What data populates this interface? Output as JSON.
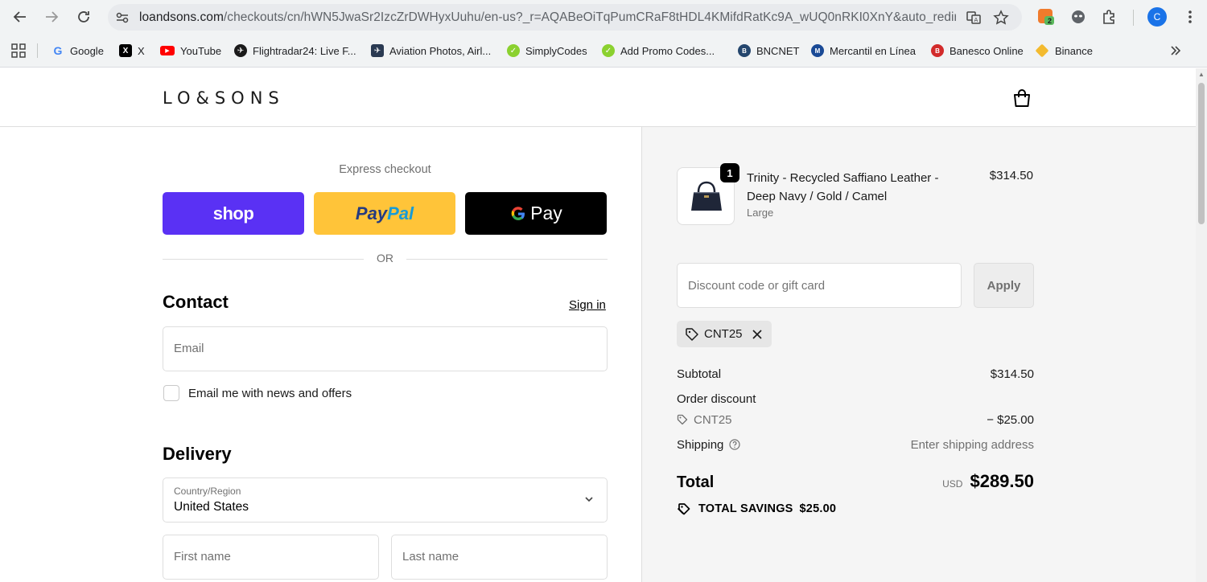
{
  "browser": {
    "url_host": "loandsons.com",
    "url_path": "/checkouts/cn/hWN5JwaSr2IzcZrDWHyxUuhu/en-us?_r=AQABeOiTqPumCRaF8tHDL4KMifdRatKc9A_wUQ0nRKI0XnY&auto_redirect=...",
    "extension_badge": "2",
    "profile_initial": "C",
    "bookmarks": [
      "Google",
      "X",
      "YouTube",
      "Flightradar24: Live F...",
      "Aviation Photos, Airl...",
      "SimplyCodes",
      "Add Promo Codes...",
      "BNCNET",
      "Mercantil en Línea",
      "Banesco Online",
      "Binance"
    ]
  },
  "header": {
    "logo": "LO&SONS"
  },
  "checkout": {
    "express_label": "Express checkout",
    "shop_label": "shop",
    "paypal_part1": "Pay",
    "paypal_part2": "Pal",
    "gpay_g": "G",
    "gpay_label": "Pay",
    "or_label": "OR",
    "contact_title": "Contact",
    "sign_in": "Sign in",
    "email_placeholder": "Email",
    "news_label": "Email me with news and offers",
    "delivery_title": "Delivery",
    "country_label": "Country/Region",
    "country_value": "United States",
    "first_name_placeholder": "First name",
    "last_name_placeholder": "Last name"
  },
  "summary": {
    "qty": "1",
    "product_name": "Trinity - Recycled Saffiano Leather - Deep Navy / Gold / Camel",
    "variant": "Large",
    "price": "$314.50",
    "discount_placeholder": "Discount code or gift card",
    "apply_label": "Apply",
    "applied_code": "CNT25",
    "subtotal_label": "Subtotal",
    "subtotal_value": "$314.50",
    "order_discount_label": "Order discount",
    "discount_code": "CNT25",
    "discount_value": "− $25.00",
    "shipping_label": "Shipping",
    "shipping_value": "Enter shipping address",
    "total_label": "Total",
    "currency": "USD",
    "total_value": "$289.50",
    "savings_label": "TOTAL SAVINGS",
    "savings_value": "$25.00"
  },
  "colors": {
    "shop": "#5a31f4",
    "paypal": "#ffc439",
    "gpay": "#000000",
    "summary_bg": "#f5f5f5"
  }
}
